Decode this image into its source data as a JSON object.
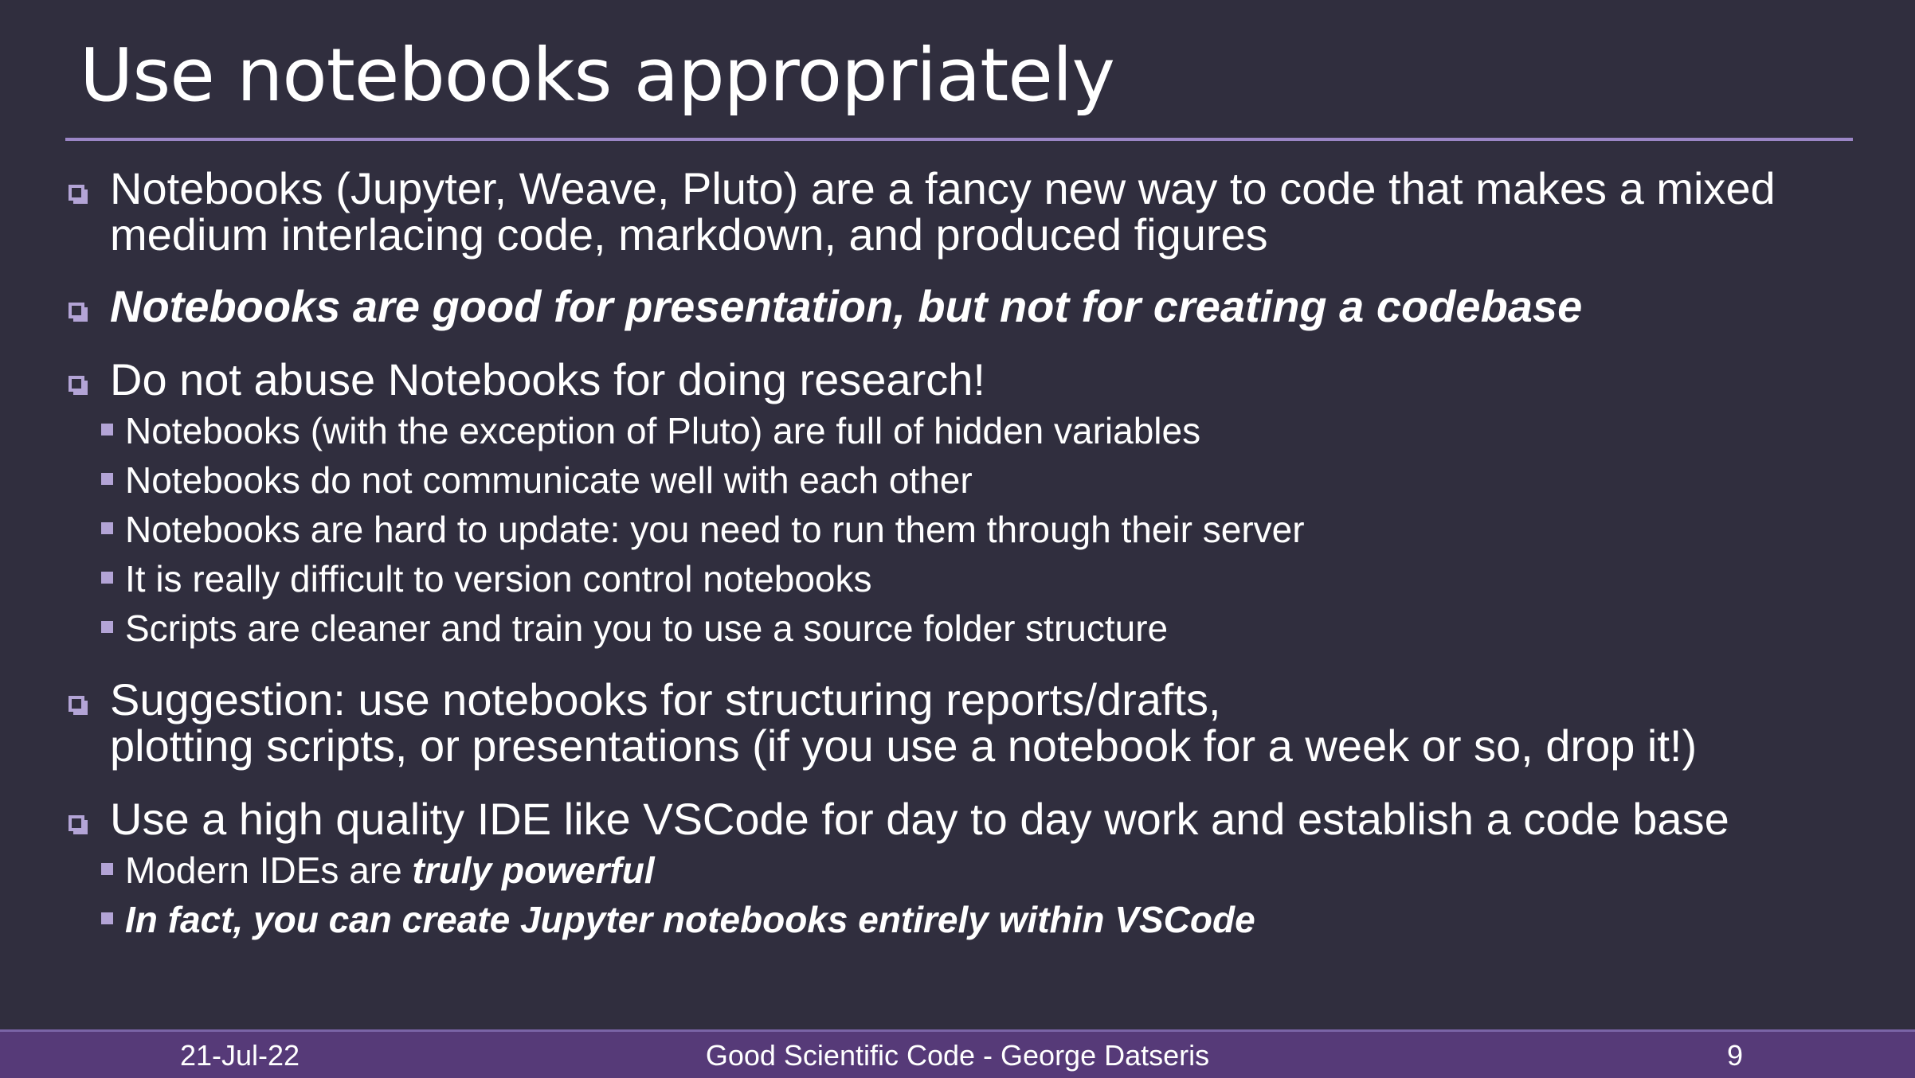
{
  "slide": {
    "title": "Use notebooks appropriately",
    "bullets": [
      {
        "line1": "Notebooks (Jupyter, Weave, Pluto) are a fancy new way to code that makes a mixed",
        "line2": "medium interlacing code, markdown, and produced figures"
      },
      {
        "text": "Notebooks are good for presentation, but not for creating a codebase"
      },
      {
        "text": "Do not abuse Notebooks for doing research!",
        "subs": [
          "Notebooks (with the exception of Pluto) are full of hidden variables",
          "Notebooks do not communicate well with each other",
          "Notebooks are hard to update: you need to run them through their server",
          "It is really difficult to version control notebooks",
          "Scripts are cleaner and train you to use a source folder structure"
        ]
      },
      {
        "line1": "Suggestion: use notebooks for structuring reports/drafts,",
        "line2": "plotting scripts, or presentations (if you use a notebook for a week or so, drop it!)"
      },
      {
        "text": "Use a high quality IDE like VSCode for day to day work and establish a code base",
        "subs": [
          {
            "prefix": "Modern IDEs are ",
            "emphasis": "truly powerful"
          },
          "In fact, you can create Jupyter notebooks entirely within VSCode"
        ]
      }
    ]
  },
  "footer": {
    "date": "21-Jul-22",
    "center": "Good Scientific Code - George Datseris",
    "page": "9"
  },
  "colors": {
    "background": "#302e3e",
    "accent": "#b3a4d6",
    "rule": "#9b86c6",
    "footer_bar": "#563a78"
  }
}
